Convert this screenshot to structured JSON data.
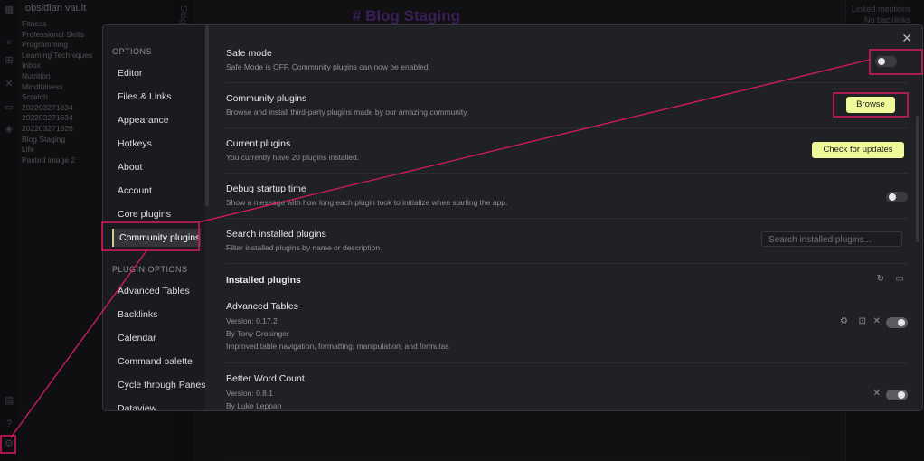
{
  "background": {
    "vault_name": "obsidian vault",
    "note_title": "# Blog Staging",
    "sidetab_text": "Stagin",
    "right_pane_text": "Linked mentions",
    "right_pane_sub": "No backlinks",
    "tree": [
      "Fitness",
      "Professional Skills",
      "Programming",
      "Learning Techniques",
      "Inbox",
      "Nutrition",
      "Mindfulness",
      "Scratch",
      "202203271634",
      "202203271634",
      "202203271626",
      "Blog Staging",
      "Life",
      "Pasted image 2"
    ]
  },
  "nav": {
    "options_header": "OPTIONS",
    "items": [
      "Editor",
      "Files & Links",
      "Appearance",
      "Hotkeys",
      "About",
      "Account",
      "Core plugins",
      "Community plugins"
    ],
    "plugin_options_header": "PLUGIN OPTIONS",
    "plugin_items": [
      "Advanced Tables",
      "Backlinks",
      "Calendar",
      "Command palette",
      "Cycle through Panes",
      "Dataview"
    ]
  },
  "settings": {
    "close": "✕",
    "safe_mode": {
      "name": "Safe mode",
      "desc": "Safe Mode is OFF. Community plugins can now be enabled.",
      "enabled": false
    },
    "community": {
      "name": "Community plugins",
      "desc": "Browse and install third-party plugins made by our amazing community.",
      "button": "Browse"
    },
    "current": {
      "name": "Current plugins",
      "desc": "You currently have 20 plugins installed.",
      "button": "Check for updates"
    },
    "debug": {
      "name": "Debug startup time",
      "desc": "Show a message with how long each plugin took to initialize when starting the app.",
      "enabled": false
    },
    "search": {
      "name": "Search installed plugins",
      "desc": "Filter installed plugins by name or description.",
      "placeholder": "Search installed plugins..."
    },
    "installed_header": "Installed plugins",
    "plugins": [
      {
        "name": "Advanced Tables",
        "version": "Version: 0.17.2",
        "author": "By Tony Grosinger",
        "desc": "Improved table navigation, formatting, manipulation, and formulas",
        "enabled": true
      },
      {
        "name": "Better Word Count",
        "version": "Version: 0.8.1",
        "author": "By Luke Leppan",
        "desc": "",
        "enabled": true
      }
    ]
  },
  "colors": {
    "accent": "#eff99a",
    "annotation": "#d81b60",
    "active_nav": "#34353b"
  }
}
